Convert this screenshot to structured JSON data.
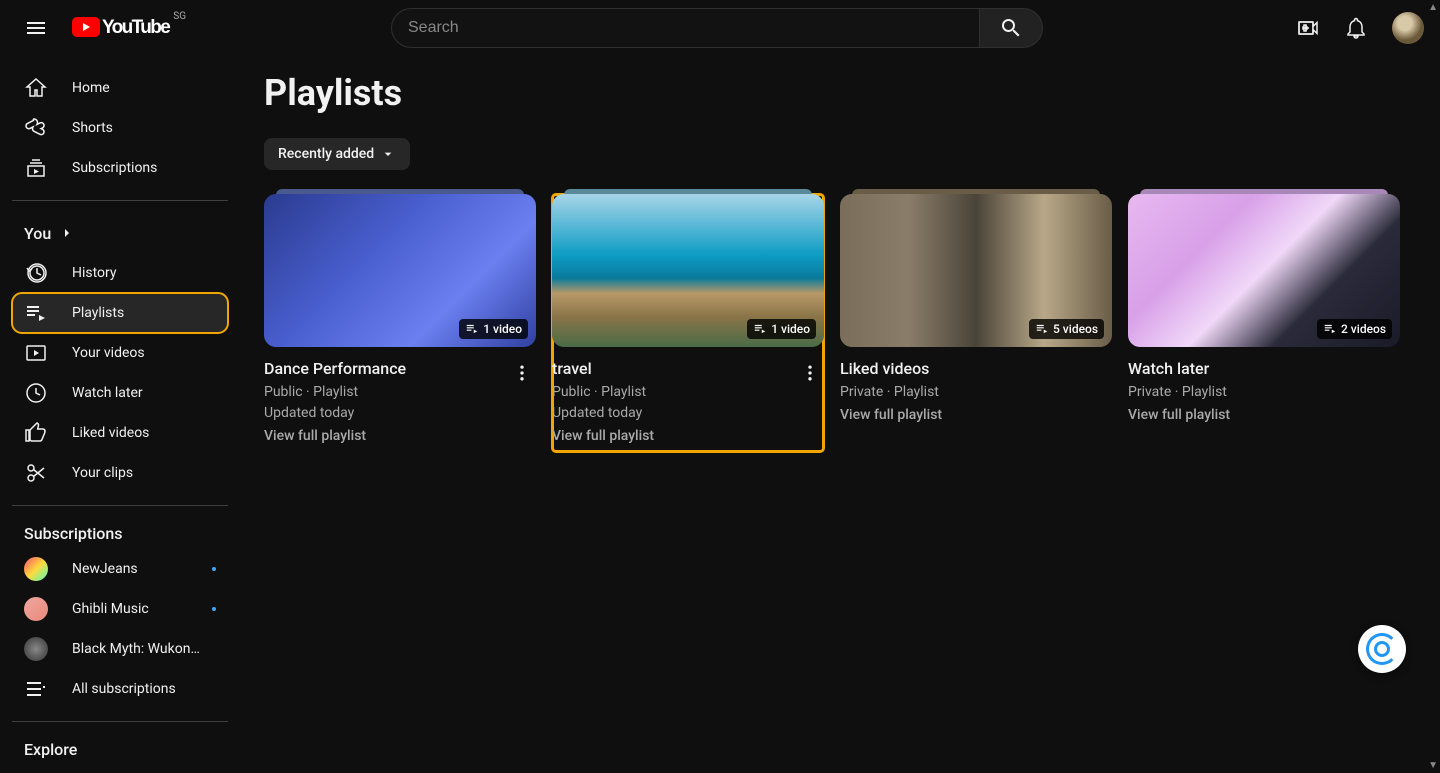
{
  "logo": {
    "text": "YouTube",
    "country": "SG"
  },
  "search": {
    "placeholder": "Search"
  },
  "sidebar": {
    "primary": [
      {
        "label": "Home",
        "icon": "home"
      },
      {
        "label": "Shorts",
        "icon": "shorts"
      },
      {
        "label": "Subscriptions",
        "icon": "subscriptions"
      }
    ],
    "you_header": "You",
    "you": [
      {
        "label": "History",
        "icon": "history"
      },
      {
        "label": "Playlists",
        "icon": "playlists",
        "active": true
      },
      {
        "label": "Your videos",
        "icon": "your-videos"
      },
      {
        "label": "Watch later",
        "icon": "watch-later"
      },
      {
        "label": "Liked videos",
        "icon": "liked"
      },
      {
        "label": "Your clips",
        "icon": "clips"
      }
    ],
    "subs_header": "Subscriptions",
    "subs": [
      {
        "label": "NewJeans",
        "color": "linear-gradient(135deg,#ff4d6d,#ffd93d,#4dffb8)",
        "dot": true
      },
      {
        "label": "Ghibli Music",
        "color": "linear-gradient(135deg,#f0a8a0,#e8887a)",
        "dot": true
      },
      {
        "label": "Black Myth: Wukon…",
        "color": "radial-gradient(circle,#888,#333)",
        "dot": false
      }
    ],
    "all_subs": "All subscriptions",
    "explore_header": "Explore"
  },
  "page": {
    "title": "Playlists",
    "chip": "Recently added"
  },
  "playlists": [
    {
      "title": "Dance Performance",
      "meta1": "Public · Playlist",
      "meta2": "Updated today",
      "link": "View full playlist",
      "badge": "1 video",
      "menu": true,
      "stackColor": "#4a5a8f"
    },
    {
      "title": "travel",
      "meta1": "Public · Playlist",
      "meta2": "Updated today",
      "link": "View full playlist",
      "badge": "1 video",
      "menu": true,
      "highlight": true,
      "stackColor": "#5a8a9a"
    },
    {
      "title": "Liked videos",
      "meta1": "Private · Playlist",
      "meta2": "",
      "link": "View full playlist",
      "badge": "5 videos",
      "menu": false,
      "stackColor": "#6a5d48"
    },
    {
      "title": "Watch later",
      "meta1": "Private · Playlist",
      "meta2": "",
      "link": "View full playlist",
      "badge": "2 videos",
      "menu": false,
      "stackColor": "#a888b8"
    }
  ]
}
